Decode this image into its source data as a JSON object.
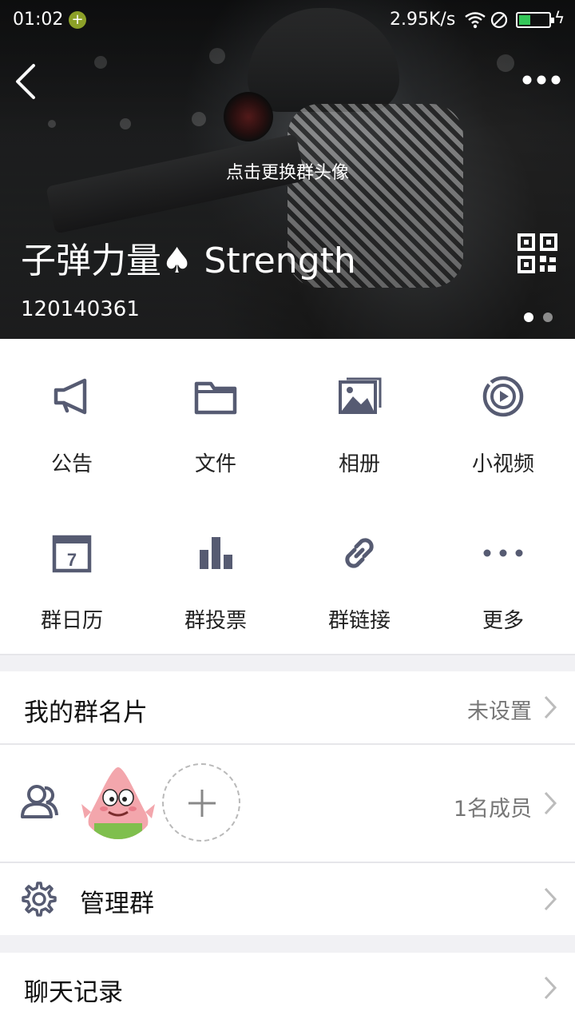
{
  "status_bar": {
    "time": "01:02",
    "net_speed": "2.95K/s"
  },
  "header": {
    "change_avatar_hint": "点击更换群头像",
    "group_name": "子弹力量♠ Strength",
    "group_id": "120140361"
  },
  "functions": [
    {
      "label": "公告",
      "icon": "megaphone-icon"
    },
    {
      "label": "文件",
      "icon": "folder-icon"
    },
    {
      "label": "相册",
      "icon": "photo-album-icon"
    },
    {
      "label": "小视频",
      "icon": "video-play-icon"
    },
    {
      "label": "群日历",
      "icon": "calendar-icon",
      "calendar_day": "7"
    },
    {
      "label": "群投票",
      "icon": "bar-chart-icon"
    },
    {
      "label": "群链接",
      "icon": "link-icon"
    },
    {
      "label": "更多",
      "icon": "more-dots-icon"
    }
  ],
  "my_card": {
    "label": "我的群名片",
    "value": "未设置"
  },
  "members": {
    "count_text": "1名成员"
  },
  "manage": {
    "label": "管理群"
  },
  "chat_history": {
    "label": "聊天记录"
  },
  "colors": {
    "icon": "#565b72",
    "accent_green": "#8ca028",
    "battery": "#34c759"
  }
}
